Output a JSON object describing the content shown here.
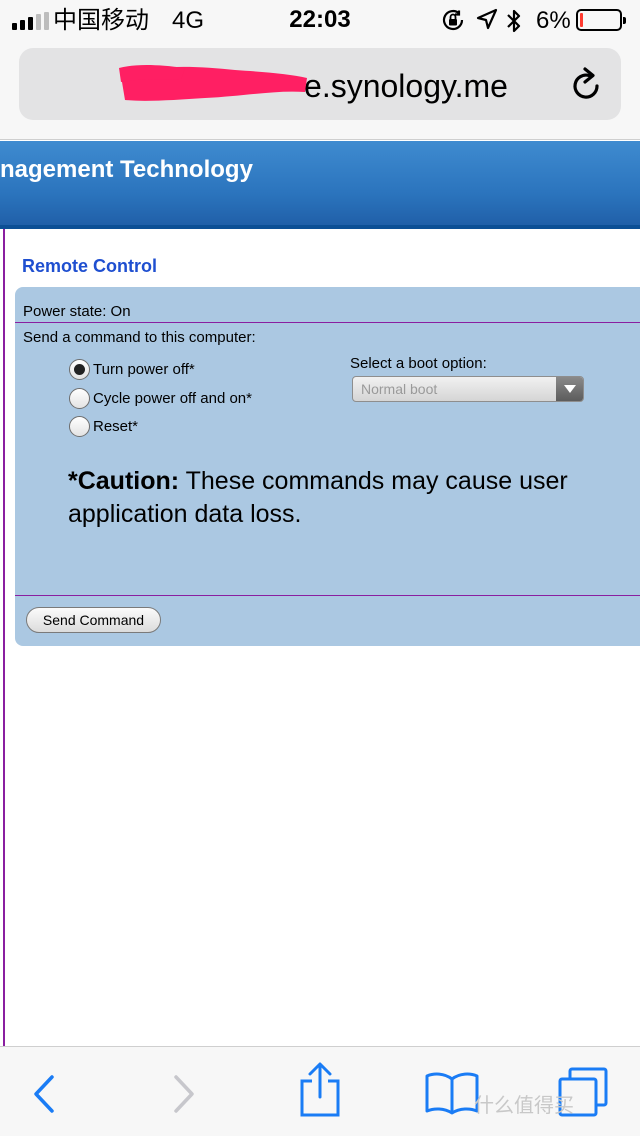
{
  "status_bar": {
    "carrier": "中国移动",
    "network": "4G",
    "time": "22:03",
    "battery_percent": "6%",
    "battery_level": 0.06,
    "icons": [
      "signal-icon",
      "orientation-lock-icon",
      "location-icon",
      "bluetooth-icon",
      "battery-icon"
    ],
    "battery_color": "#ff3b30"
  },
  "browser": {
    "url_text": "e.synology.me",
    "url_icons": [
      "redaction-mark",
      "reload-icon"
    ]
  },
  "banner": {
    "title": "nagement Technology",
    "color": "#2b74bd"
  },
  "remote_control": {
    "title": "Remote Control",
    "power_state": "Power state: On",
    "command_prompt": "Send a command to this computer:",
    "options": [
      {
        "label": "Turn power off*",
        "checked": true
      },
      {
        "label": "Cycle power off and on*",
        "checked": false
      },
      {
        "label": "Reset*",
        "checked": false
      }
    ],
    "boot_label": "Select a boot option:",
    "boot_selected": "Normal boot",
    "caution_bold": "*Caution:",
    "caution_text": "These commands may cause user application data loss.",
    "send_button": "Send Command",
    "panel_color": "#abc8e2",
    "rule_color": "#8a1fa0",
    "title_color": "#1f4fd0"
  },
  "toolbar": {
    "icons": [
      "back-icon",
      "forward-icon",
      "share-icon",
      "bookmarks-icon",
      "tabs-icon"
    ],
    "accent": "#1a7cf5",
    "watermark": "什么值得买"
  }
}
